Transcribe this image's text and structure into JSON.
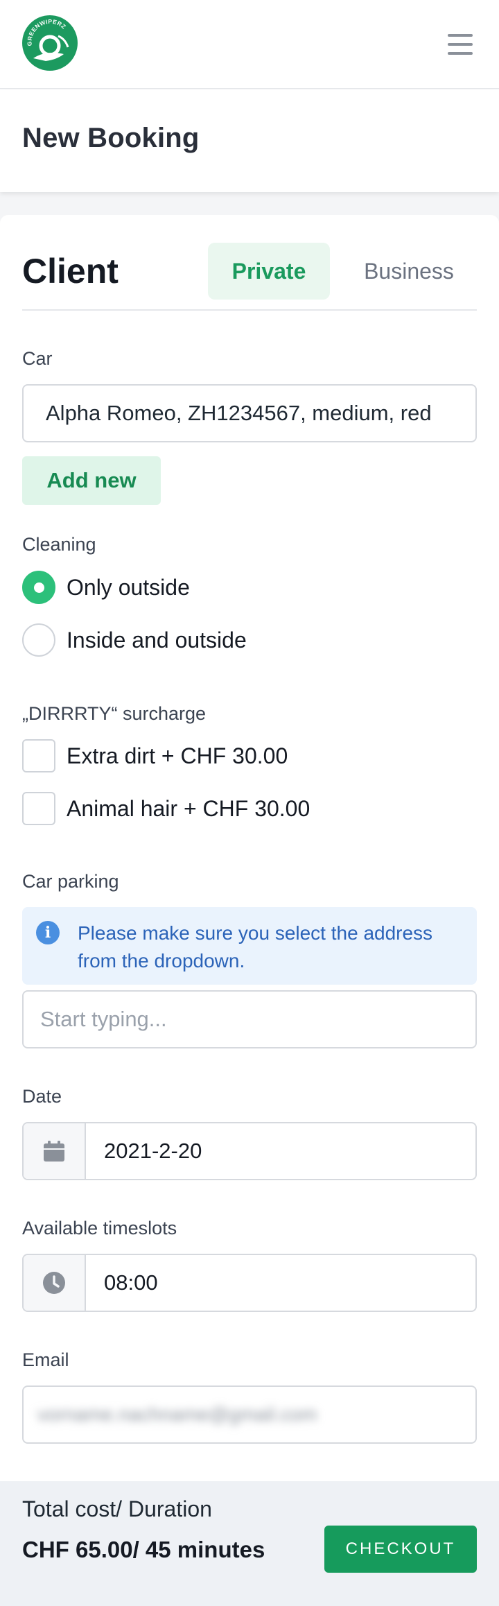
{
  "brand": {
    "logo_text": "GREENWIPERZ",
    "accent": "#1c9a5f"
  },
  "header": {
    "title": "New Booking",
    "menu_icon": "hamburger-menu-icon"
  },
  "client": {
    "title": "Client",
    "tabs": [
      {
        "label": "Private",
        "active": true
      },
      {
        "label": "Business",
        "active": false
      }
    ]
  },
  "car": {
    "label": "Car",
    "selected": "Alpha Romeo, ZH1234567, medium, red",
    "add_new_label": "Add new"
  },
  "cleaning": {
    "label": "Cleaning",
    "options": [
      {
        "label": "Only outside",
        "selected": true
      },
      {
        "label": "Inside and outside",
        "selected": false
      }
    ]
  },
  "surcharge": {
    "label": "„DIRRRTY“ surcharge",
    "options": [
      {
        "label": "Extra dirt + CHF 30.00",
        "checked": false
      },
      {
        "label": "Animal hair + CHF 30.00",
        "checked": false
      }
    ]
  },
  "parking": {
    "label": "Car parking",
    "info": "Please make sure you select the address from the dropdown.",
    "placeholder": "Start typing..."
  },
  "date": {
    "label": "Date",
    "value": "2021-2-20",
    "icon": "calendar-icon"
  },
  "timeslots": {
    "label": "Available timeslots",
    "value": "08:00",
    "icon": "clock-icon"
  },
  "email": {
    "label": "Email",
    "value": "vorname.nachname@gmail.com"
  },
  "footer": {
    "total_label": "Total cost/ Duration",
    "total_value": "CHF 65.00/ 45 minutes",
    "checkout_label": "CHECKOUT"
  }
}
